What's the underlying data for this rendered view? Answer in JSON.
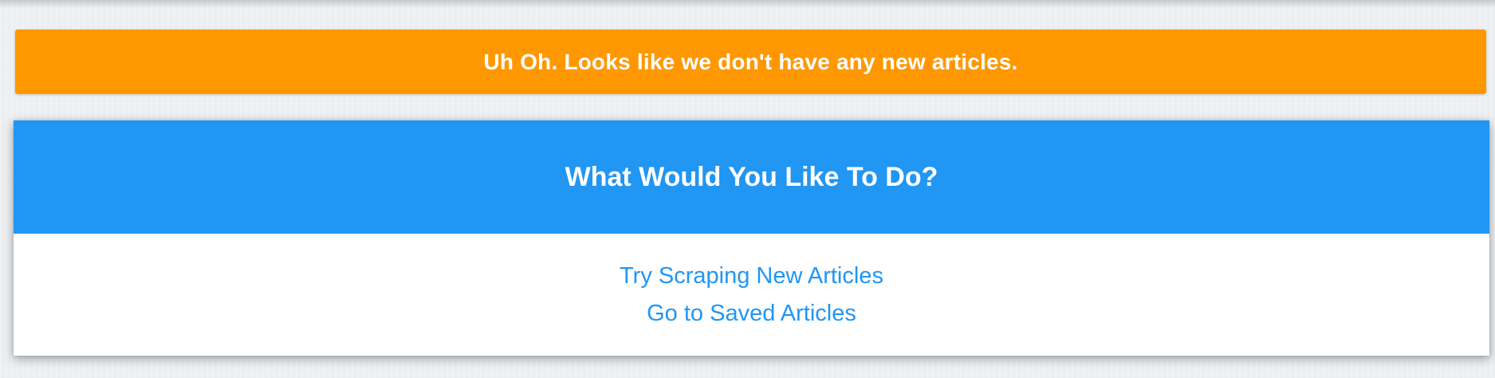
{
  "alert": {
    "message": "Uh Oh. Looks like we don't have any new articles."
  },
  "panel": {
    "title": "What Would You Like To Do?",
    "actions": [
      {
        "label": "Try Scraping New Articles"
      },
      {
        "label": "Go to Saved Articles"
      }
    ]
  },
  "colors": {
    "alert_background": "#ff9800",
    "header_background": "#2196f3",
    "link": "#2196f3"
  }
}
